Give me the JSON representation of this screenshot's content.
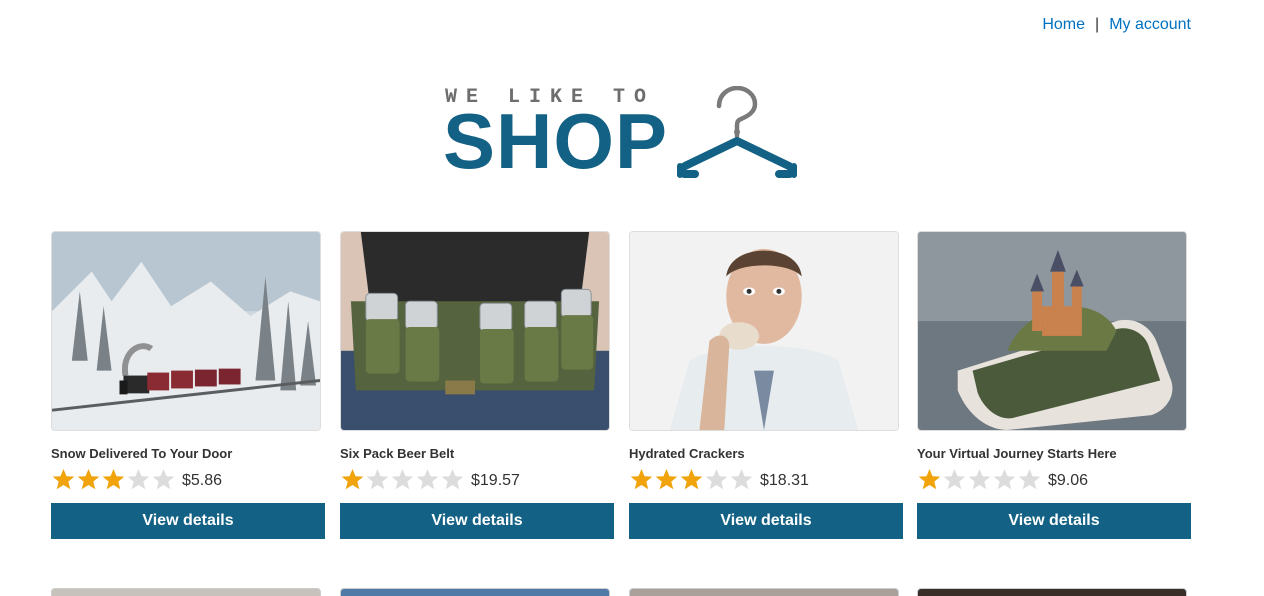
{
  "nav": {
    "home": "Home",
    "separator": "|",
    "account": "My account"
  },
  "logo": {
    "tagline": "WE LIKE TO",
    "word": "SHOP"
  },
  "colors": {
    "accent": "#136184",
    "link": "#0071c1",
    "star_on": "#f0a30a",
    "star_off": "#dcdcdc"
  },
  "products": [
    {
      "title": "Snow Delivered To Your Door",
      "rating": 3,
      "price": "$5.86",
      "button": "View details",
      "image": "snowy-train-photo"
    },
    {
      "title": "Six Pack Beer Belt",
      "rating": 1,
      "price": "$19.57",
      "button": "View details",
      "image": "beer-belt-photo"
    },
    {
      "title": "Hydrated Crackers",
      "rating": 3,
      "price": "$18.31",
      "button": "View details",
      "image": "man-eating-cracker-photo"
    },
    {
      "title": "Your Virtual Journey Starts Here",
      "rating": 1,
      "price": "$9.06",
      "button": "View details",
      "image": "castle-on-phone-photo"
    }
  ]
}
